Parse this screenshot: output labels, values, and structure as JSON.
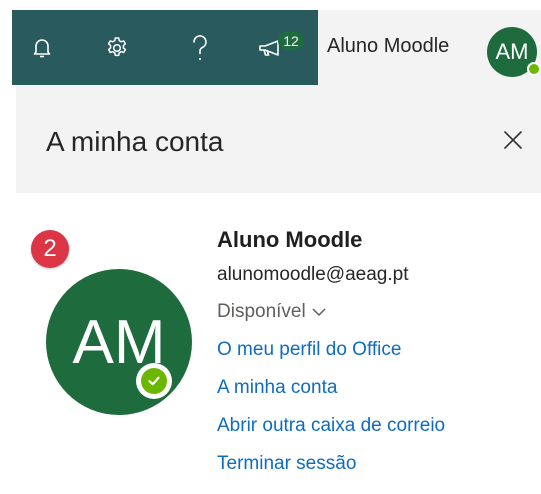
{
  "topbar": {
    "icons": [
      "bell-icon",
      "gear-icon",
      "help-icon",
      "megaphone-icon"
    ],
    "notification_count": "12",
    "colors": {
      "background": "#295a5d",
      "badge": "#1e6b3e"
    }
  },
  "user_button": {
    "name": "Aluno Moodle",
    "initials": "AM",
    "avatar_color": "#1e6b3e",
    "status_color": "#6bb700"
  },
  "panel": {
    "title": "A minha conta",
    "step_number": "2",
    "avatar_initials": "AM",
    "name": "Aluno Moodle",
    "email": "alunomoodle@aeag.pt",
    "presence": "Disponível",
    "links": [
      "O meu perfil do Office",
      "A minha conta",
      "Abrir outra caixa de correio",
      "Terminar sessão"
    ],
    "link_color": "#0f6cbd"
  }
}
